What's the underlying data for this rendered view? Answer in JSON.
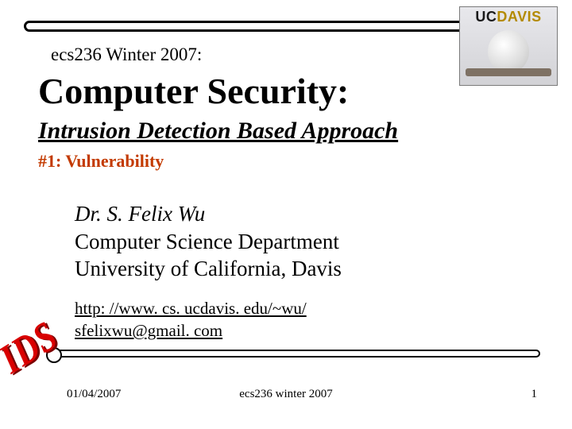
{
  "logo": {
    "uc": "UC",
    "davis": "DAVIS"
  },
  "course_line": "ecs236 Winter 2007:",
  "title_main": "Computer Security:",
  "subtitle": "Intrusion Detection Based Approach",
  "section_label": "#1: Vulnerability",
  "author": {
    "name": "Dr. S. Felix Wu",
    "dept": "Computer Science Department",
    "univ": "University of California, Davis"
  },
  "links": {
    "url": "http: //www. cs. ucdavis. edu/~wu/",
    "email": "sfelixwu@gmail. com"
  },
  "ids_art": "IDS",
  "footer": {
    "date": "01/04/2007",
    "center": "ecs236 winter 2007",
    "page": "1"
  }
}
